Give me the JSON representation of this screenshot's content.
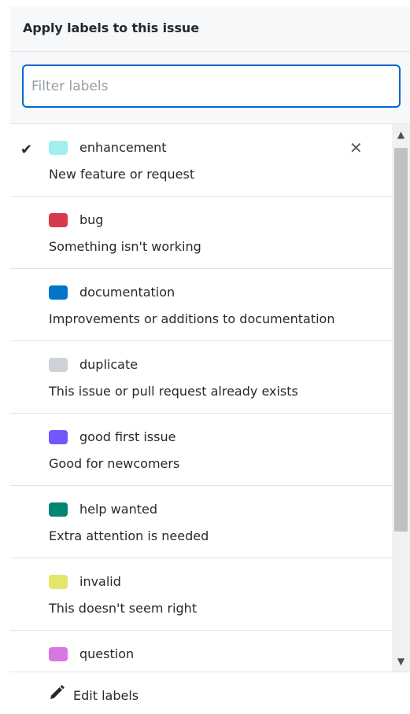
{
  "header": {
    "title": "Apply labels to this issue"
  },
  "filter": {
    "placeholder": "Filter labels",
    "value": ""
  },
  "labels": [
    {
      "name": "enhancement",
      "description": "New feature or request",
      "color": "#a2eeef",
      "selected": true
    },
    {
      "name": "bug",
      "description": "Something isn't working",
      "color": "#d73a4a",
      "selected": false
    },
    {
      "name": "documentation",
      "description": "Improvements or additions to documentation",
      "color": "#0075ca",
      "selected": false
    },
    {
      "name": "duplicate",
      "description": "This issue or pull request already exists",
      "color": "#cfd3d7",
      "selected": false
    },
    {
      "name": "good first issue",
      "description": "Good for newcomers",
      "color": "#7057ff",
      "selected": false
    },
    {
      "name": "help wanted",
      "description": "Extra attention is needed",
      "color": "#008672",
      "selected": false
    },
    {
      "name": "invalid",
      "description": "This doesn't seem right",
      "color": "#e4e669",
      "selected": false
    },
    {
      "name": "question",
      "description": "",
      "color": "#d876e3",
      "selected": false
    }
  ],
  "icons": {
    "check": "check-icon",
    "remove": "close-icon",
    "edit": "pencil-icon",
    "scroll_up": "chevron-up-icon",
    "scroll_down": "chevron-down-icon"
  },
  "footer": {
    "edit_label": "Edit labels"
  }
}
